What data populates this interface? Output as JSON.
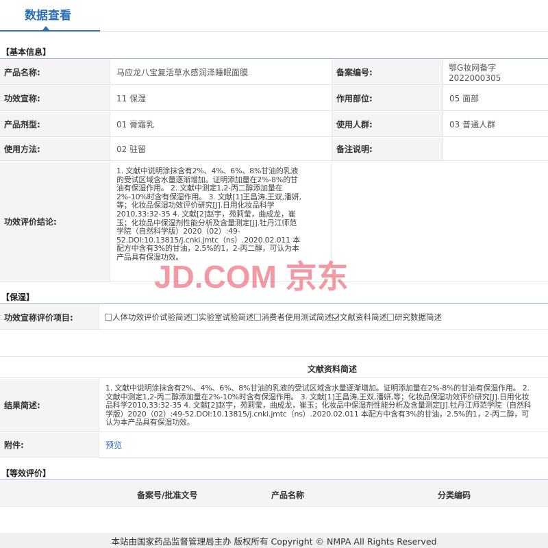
{
  "page": {
    "tab_title": "数据查看"
  },
  "basic": {
    "section_title": "【基本信息】",
    "product_name_label": "产品名称:",
    "product_name": "马应龙八宝复活草水感润泽睡眠面膜",
    "record_no_label": "备案编号:",
    "record_no": "鄂G妆网备字2022000305",
    "claim_label": "功效宣称:",
    "claim": "11 保湿",
    "part_label": "作用部位:",
    "part": "05 面部",
    "form_label": "产品剂型:",
    "form": "01 膏霜乳",
    "users_label": "使用人群:",
    "users": "03 普通人群",
    "usage_label": "使用方法:",
    "usage": "02 驻留",
    "remark_label": "备注说明:",
    "remark": "",
    "conclusion_label": "功效评价结论:",
    "conclusion": "1. 文献中说明涂抹含有2%、4%、6%、8%甘油的乳液的受试区域含水量逐渐增加。证明添加量在2%-8%的甘油有保湿作用。 2. 文献中测定1,2-丙二醇添加量在2%-10%时含有保湿作用。 3. 文献[1]王昌涛,王双,潘妍,等；化妆品保湿功效评价研究[J].日用化妆品科学2010,33:32-35 4. 文献[2]赵宇，苑莉莹，曲成龙，崔玉；化妆品中保湿剂性能分析及含量测定[J].牡丹江师范学院（自然科学版）2020（02）:49-52.DOI:10.13815/j.cnki.jmtc（ns）.2020.02.011 本配方中含有3%的甘油，2.5%的1，2-丙二醇，可认为本产品具有保湿功效。"
  },
  "moisture": {
    "section_title": "【保湿】",
    "eval_label": "功效宣称评价项目:",
    "options": [
      {
        "label": "人体功效评价试验简述",
        "checked": false
      },
      {
        "label": "实验室试验简述",
        "checked": false
      },
      {
        "label": "消费者使用测试简述",
        "checked": false
      },
      {
        "label": "文献资料简述",
        "checked": true
      },
      {
        "label": "研究数据简述",
        "checked": false
      }
    ],
    "subheading": "文献资料简述",
    "result_label": "结果简述:",
    "result": "1. 文献中说明涂抹含有2%、4%、6%、8%甘油的乳液的受试区域含水量逐渐增加。证明添加量在2%-8%的甘油有保湿作用。 2. 文献中测定1,2-丙二醇添加量在2%-10%时含有保湿作用。 3. 文献[1]王昌涛,王双,潘妍,等；化妆品保湿功效评价研究[J].日用化妆品科学2010,33:32-35 4. 文献[2]赵宇，苑莉莹，曲成龙，崔玉；化妆品中保湿剂性能分析及含量测定[J].牡丹江师范学院（自然科学版）2020（02）:49-52.DOI:10.13815/j.cnki.jmtc（ns）.2020.02.011 本配方中含有3%的甘油，2.5%的1，2-丙二醇，可认为本产品具有保湿功效。",
    "attach_label": "附件:",
    "attach_link": "预览"
  },
  "equiv": {
    "section_title": "【等效评价】",
    "col_record": "备案号/批准文号",
    "col_name": "产品名称",
    "col_category": "分类编码"
  },
  "watermark": "JD.COM 京东",
  "footer": "本站由国家药品监督管理局主办 版权所有 Copyright © NMPA All Rights Reserved"
}
